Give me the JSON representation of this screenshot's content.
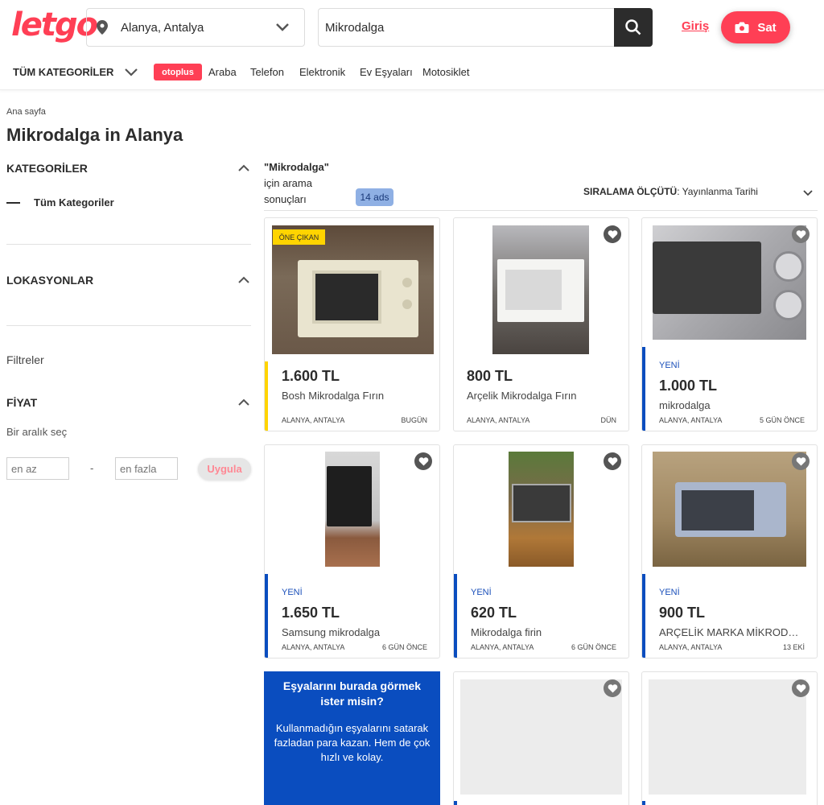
{
  "header": {
    "logo": "letgo",
    "location": "Alanya, Antalya",
    "search_value": "Mikrodalga",
    "login": "Giriş",
    "sell": "Sat"
  },
  "nav": {
    "all_categories": "TÜM KATEGORİLER",
    "otoplus": "otoplus",
    "links": [
      "Araba",
      "Telefon",
      "Elektronik",
      "Ev Eşyaları",
      "Motosiklet"
    ]
  },
  "sidebar": {
    "breadcrumb": "Ana sayfa",
    "title": "Mikrodalga in Alanya",
    "categories_heading": "KATEGORİLER",
    "all_categories_link": "Tüm Kategoriler",
    "locations_heading": "LOKASYONLAR",
    "filters_label": "Filtreler",
    "price_heading": "FİYAT",
    "range_label": "Bir aralık seç",
    "min_placeholder": "en az",
    "max_placeholder": "en fazla",
    "range_separator": "-",
    "apply": "Uygula"
  },
  "results": {
    "query": "\"Mikrodalga\"",
    "line2": "için arama",
    "line3": "sonuçları",
    "count": "14 ads",
    "sort_label": "SIRALAMA ÖLÇÜTÜ",
    "sort_value": ": Yayınlanma Tarihi"
  },
  "listings": [
    {
      "price": "1.600 TL",
      "title": "Bosh Mikrodalga Fırın",
      "location": "ALANYA, ANTALYA",
      "when": "BUGÜN",
      "badge": "ÖNE ÇIKAN"
    },
    {
      "price": "800 TL",
      "title": "Arçelik Mikrodalga Fırın",
      "location": "ALANYA, ANTALYA",
      "when": "DÜN"
    },
    {
      "tag": "YENİ",
      "price": "1.000 TL",
      "title": "mikrodalga",
      "location": "ALANYA, ANTALYA",
      "when": "5 GÜN ÖNCE"
    },
    {
      "tag": "YENİ",
      "price": "1.650 TL",
      "title": "Samsung mikrodalga",
      "location": "ALANYA, ANTALYA",
      "when": "6 GÜN ÖNCE"
    },
    {
      "tag": "YENİ",
      "price": "620 TL",
      "title": "Mikrodalga firin",
      "location": "ALANYA, ANTALYA",
      "when": "6 GÜN ÖNCE"
    },
    {
      "tag": "YENİ",
      "price": "900 TL",
      "title": "ARÇELİK MARKA MİKRODAL...",
      "location": "ALANYA, ANTALYA",
      "when": "13 EKİ"
    }
  ],
  "promo": {
    "heading": "Eşyalarını burada görmek ister misin?",
    "body": "Kullanmadığın eşyalarını satarak fazladan para kazan. Hem de çok hızlı ve kolay."
  },
  "colors": {
    "brand": "#ff3f55",
    "new_accent": "#0a4dbf",
    "featured_accent": "#ffd400"
  }
}
